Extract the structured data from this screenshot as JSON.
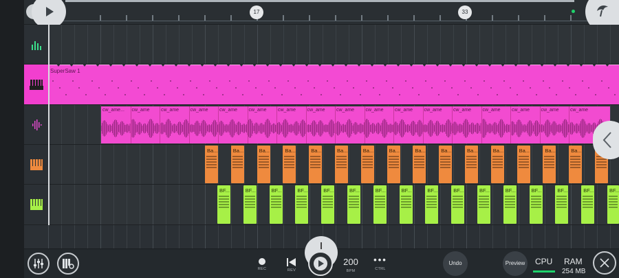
{
  "ruler": {
    "markers": [
      "17",
      "33"
    ]
  },
  "tracks": [
    {
      "name": "supersaw",
      "clip_label": "SuperSaw 1",
      "header_icon": "piano-icon",
      "color": "#f34ad3"
    },
    {
      "name": "audio",
      "header_icon": "waveform-icon",
      "color": "#f24bd0",
      "clip_labels": [
        "cw_ame...",
        "cw_ame",
        "cw_ame",
        "cw_ame",
        "cw_ame",
        "cw_ame",
        "cw_ame",
        "cw_ame",
        "cw_ame",
        "cw_ame",
        "cw_ame",
        "cw_ame",
        "cw_ame",
        "cw_ame",
        "cw_ame",
        "cw_ame",
        "cw_ame"
      ]
    },
    {
      "name": "bass",
      "header_icon": "piano-icon",
      "color": "#ef8a3e",
      "clip_label": "Ba...",
      "clip_count": 16
    },
    {
      "name": "bf",
      "header_icon": "piano-icon",
      "color": "#a7f047",
      "clip_label": "BF...",
      "clip_count": 16
    }
  ],
  "header_icons": {
    "top": "mixer-bars-icon"
  },
  "transport": {
    "rec_label": "REC",
    "rev_label": "REV",
    "bpm_value": "200",
    "bpm_label": "BPM",
    "ctrl_label": "CTRL",
    "ctrl_glyph": "•••"
  },
  "buttons": {
    "undo": "Undo",
    "preview": "Preview"
  },
  "status": {
    "cpu_label": "CPU",
    "ram_label": "RAM",
    "ram_value": "254 MB"
  },
  "colors": {
    "accent_pink": "#f34ad3",
    "orange": "#ef8a3e",
    "green": "#a7f047",
    "cpu_meter": "#1fd36b"
  }
}
